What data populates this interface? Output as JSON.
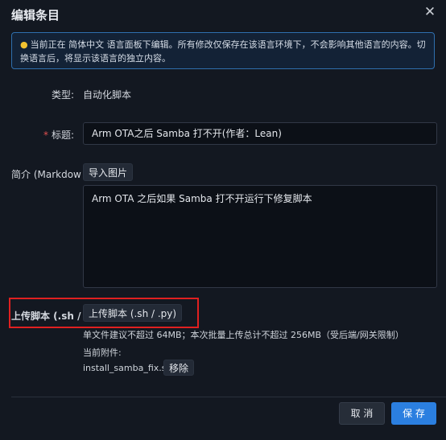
{
  "dialog": {
    "title": "编辑条目",
    "notice": "当前正在 简体中文 语言面板下编辑。所有修改仅保存在该语言环境下，不会影响其他语言的内容。切换语言后，将显示该语言的独立内容。"
  },
  "form": {
    "type_label": "类型:",
    "type_value": "自动化脚本",
    "title_required_mark": "*",
    "title_label": "标题:",
    "title_value": "Arm OTA之后 Samba 打不开(作者：Lean)",
    "intro_label": "简介 (Markdow",
    "import_image_label": "导入图片",
    "intro_value": "Arm OTA 之后如果 Samba 打不开运行下修复脚本",
    "upload_label": "上传脚本 (.sh / .",
    "upload_button_label": "上传脚本 (.sh / .py)",
    "upload_hint": "单文件建议不超过 64MB；本次批量上传总计不超过 256MB（受后端/网关限制）",
    "attachments_label": "当前附件:",
    "attachment_name": "install_samba_fix.sh",
    "remove_label": "移除"
  },
  "footer": {
    "cancel_label": "取 消",
    "save_label": "保 存"
  },
  "colors": {
    "background": "#131821",
    "primary": "#2b7fe0",
    "highlight": "#e02020",
    "required": "#e25050"
  }
}
